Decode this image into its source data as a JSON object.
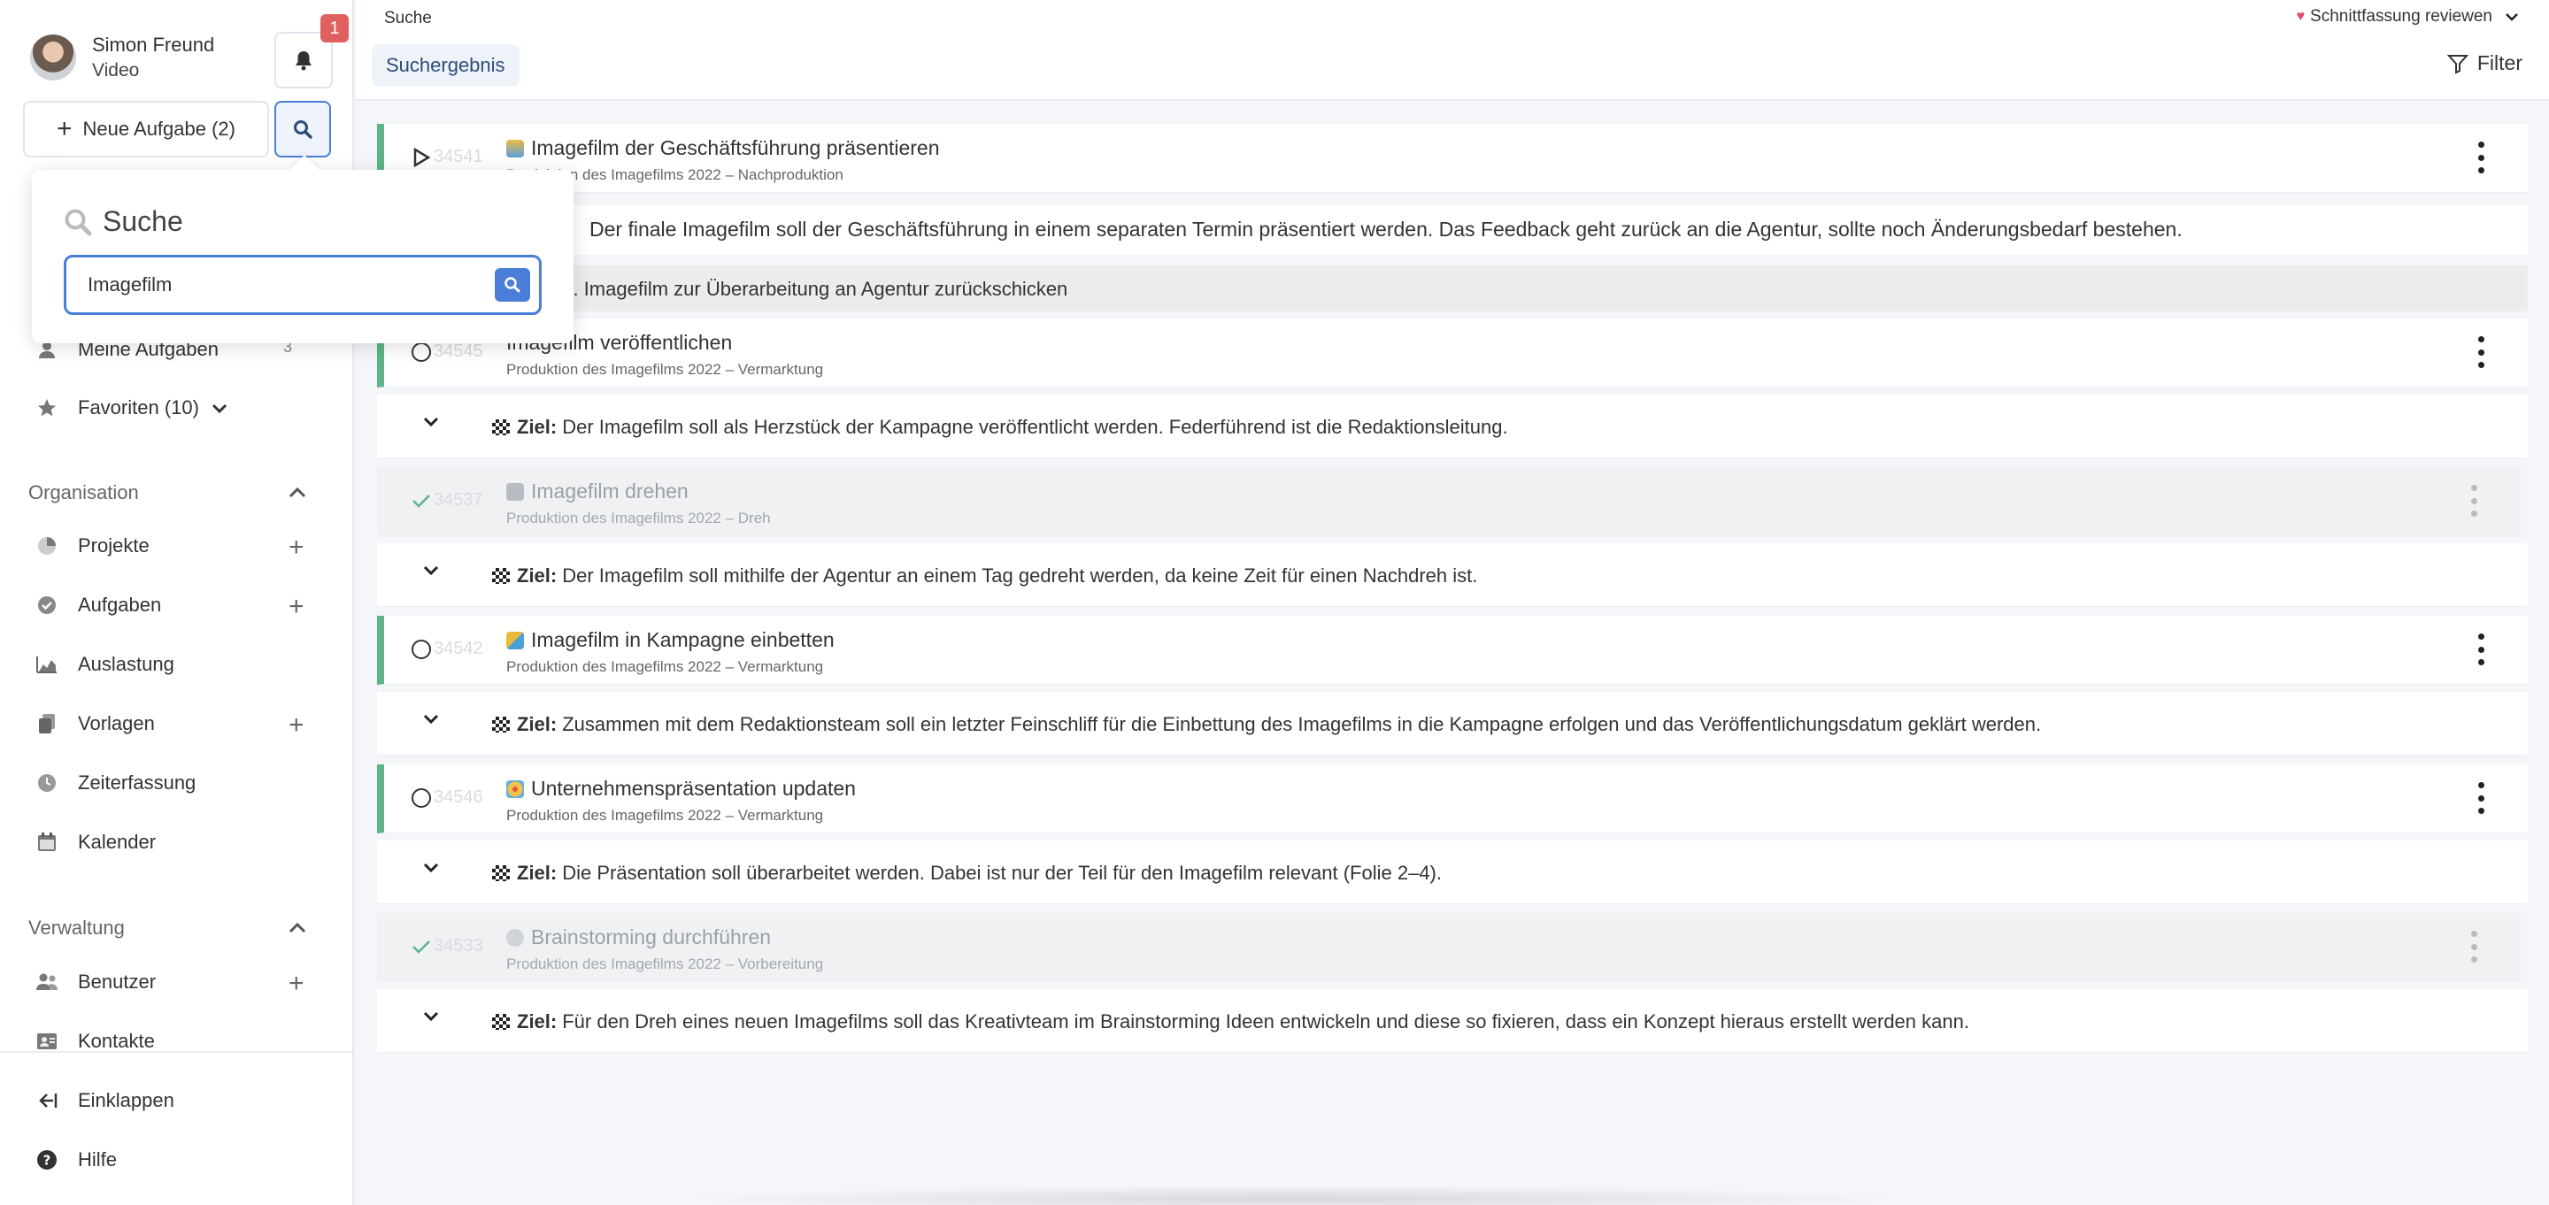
{
  "user": {
    "name": "Simon Freund",
    "role": "Video"
  },
  "notifications": {
    "count": "1"
  },
  "new_task": {
    "label": "Neue Aufgabe (2)"
  },
  "search_popup": {
    "title": "Suche",
    "value": "Imagefilm"
  },
  "sidebar": {
    "my_tasks": {
      "label": "Meine Aufgaben",
      "count": "3"
    },
    "favorites": {
      "label": "Favoriten (10)"
    },
    "organisation": {
      "heading": "Organisation",
      "items": [
        {
          "label": "Projekte",
          "icon": "pie-chart-icon"
        },
        {
          "label": "Aufgaben",
          "icon": "check-circle-icon"
        },
        {
          "label": "Auslastung",
          "icon": "area-chart-icon"
        },
        {
          "label": "Vorlagen",
          "icon": "copy-icon"
        },
        {
          "label": "Zeiterfassung",
          "icon": "clock-icon"
        },
        {
          "label": "Kalender",
          "icon": "calendar-icon"
        }
      ]
    },
    "verwaltung": {
      "heading": "Verwaltung",
      "items": [
        {
          "label": "Benutzer",
          "icon": "users-icon"
        },
        {
          "label": "Kontakte",
          "icon": "contact-card-icon"
        }
      ]
    },
    "collapse": {
      "label": "Einklappen"
    },
    "help": {
      "label": "Hilfe"
    }
  },
  "topbar": {
    "breadcrumb": "Suche",
    "tab": "Suchergebnis",
    "filter": "Filter",
    "review_selector": "Schnittfassung reviewen"
  },
  "tasks": [
    {
      "id": "34541",
      "title": "Imagefilm der Geschäftsführung präsentieren",
      "subtitle": "Produktion des Imagefilms 2022 – Nachproduktion",
      "state": "playing",
      "description": "Der finale Imagefilm soll der Geschäftsführung in einem separaten Termin präsentiert werden. Das Feedback geht zurück an die Agentur, sollte noch Änderungsbedarf bestehen.",
      "sub_item": "Ggf. Imagefilm zur Überarbeitung an Agentur zurückschicken"
    },
    {
      "id": "34545",
      "title": "Imagefilm veröffentlichen",
      "subtitle": "Produktion des Imagefilms 2022 – Vermarktung",
      "state": "open",
      "goal_label": "Ziel:",
      "goal": "Der Imagefilm soll als Herzstück der Kampagne veröffentlicht werden. Federführend ist die Redaktionsleitung."
    },
    {
      "id": "34537",
      "title": "Imagefilm drehen",
      "subtitle": "Produktion des Imagefilms 2022 – Dreh",
      "state": "done",
      "goal_label": "Ziel:",
      "goal": "Der Imagefilm soll mithilfe der Agentur an einem Tag gedreht werden, da keine Zeit für einen Nachdreh ist."
    },
    {
      "id": "34542",
      "title": "Imagefilm in Kampagne einbetten",
      "subtitle": "Produktion des Imagefilms 2022 – Vermarktung",
      "state": "open",
      "goal_label": "Ziel:",
      "goal": "Zusammen mit dem Redaktionsteam soll ein letzter Feinschliff für die Einbettung des Imagefilms in die Kampagne erfolgen und das Veröffentlichungsdatum geklärt werden."
    },
    {
      "id": "34546",
      "title": "Unternehmenspräsentation updaten",
      "subtitle": "Produktion des Imagefilms 2022 – Vermarktung",
      "state": "open",
      "goal_label": "Ziel:",
      "goal": "Die Präsentation soll überarbeitet werden. Dabei ist nur der Teil für den Imagefilm relevant (Folie 2–4)."
    },
    {
      "id": "34533",
      "title": "Brainstorming durchführen",
      "subtitle": "Produktion des Imagefilms 2022 – Vorbereitung",
      "state": "done",
      "goal_label": "Ziel:",
      "goal": "Für den Dreh eines neuen Imagefilms soll das Kreativteam im Brainstorming Ideen entwickeln und diese so fixieren, dass ein Konzept hieraus erstellt werden kann."
    }
  ],
  "colors": {
    "accent": "#4a7ed8",
    "active_bar": "#5db48a",
    "badge": "#e06060",
    "done_bg": "#f0f1f3"
  }
}
